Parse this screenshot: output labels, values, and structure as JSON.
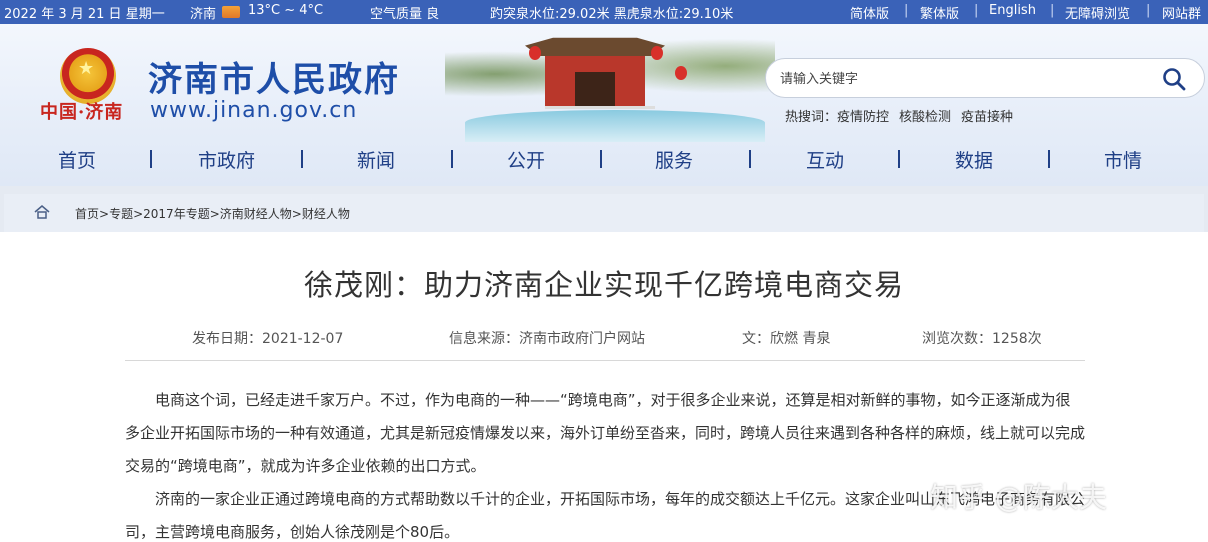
{
  "topbar": {
    "date": "2022 年 3 月 21 日 星期一",
    "city": "济南",
    "temperature": "13°C ~ 4°C",
    "air_quality": "空气质量 良",
    "spring_level": "趵突泉水位:29.02米 黑虎泉水位:29.10米",
    "links": [
      "简体版",
      "繁体版",
      "English",
      "无障碍浏览",
      "网站群"
    ]
  },
  "header": {
    "site_name": "济南市人民政府",
    "site_url": "www.jinan.gov.cn",
    "logo_text": "中国·济南"
  },
  "search": {
    "placeholder": "请输入关键字",
    "hot_label": "热搜词：",
    "hot_keywords": [
      "疫情防控",
      "核酸检测",
      "疫苗接种"
    ]
  },
  "nav": {
    "items": [
      "首页",
      "市政府",
      "新闻",
      "公开",
      "服务",
      "互动",
      "数据",
      "市情"
    ]
  },
  "breadcrumb": {
    "items": [
      "首页",
      "专题",
      "2017年专题",
      "济南财经人物",
      "财经人物"
    ],
    "separator": ">"
  },
  "article": {
    "title": "徐茂刚：助力济南企业实现千亿跨境电商交易",
    "publish_date": "发布日期：2021-12-07",
    "source": "信息来源：济南市政府门户网站",
    "author": "文：欣燃 青泉",
    "views": "浏览次数：1258次",
    "paragraphs": [
      "电商这个词，已经走进千家万户。不过，作为电商的一种——“跨境电商”，对于很多企业来说，还算是相对新鲜的事物，如今正逐渐成为很多企业开拓国际市场的一种有效通道，尤其是新冠疫情爆发以来，海外订单纷至沓来，同时，跨境人员往来遇到各种各样的麻烦，线上就可以完成交易的“跨境电商”，就成为许多企业依赖的出口方式。",
      "济南的一家企业正通过跨境电商的方式帮助数以千计的企业，开拓国际市场，每年的成交额达上千亿元。这家企业叫山东飞鸿电子商务有限公司，主营跨境电商服务，创始人徐茂刚是个80后。"
    ]
  },
  "watermark": "知乎 @陈大夫",
  "colors": {
    "topbar_bg": "#3a62b8",
    "brand_blue": "#1e4ea8",
    "nav_text": "#1f3f86",
    "logo_red": "#c8261f"
  }
}
